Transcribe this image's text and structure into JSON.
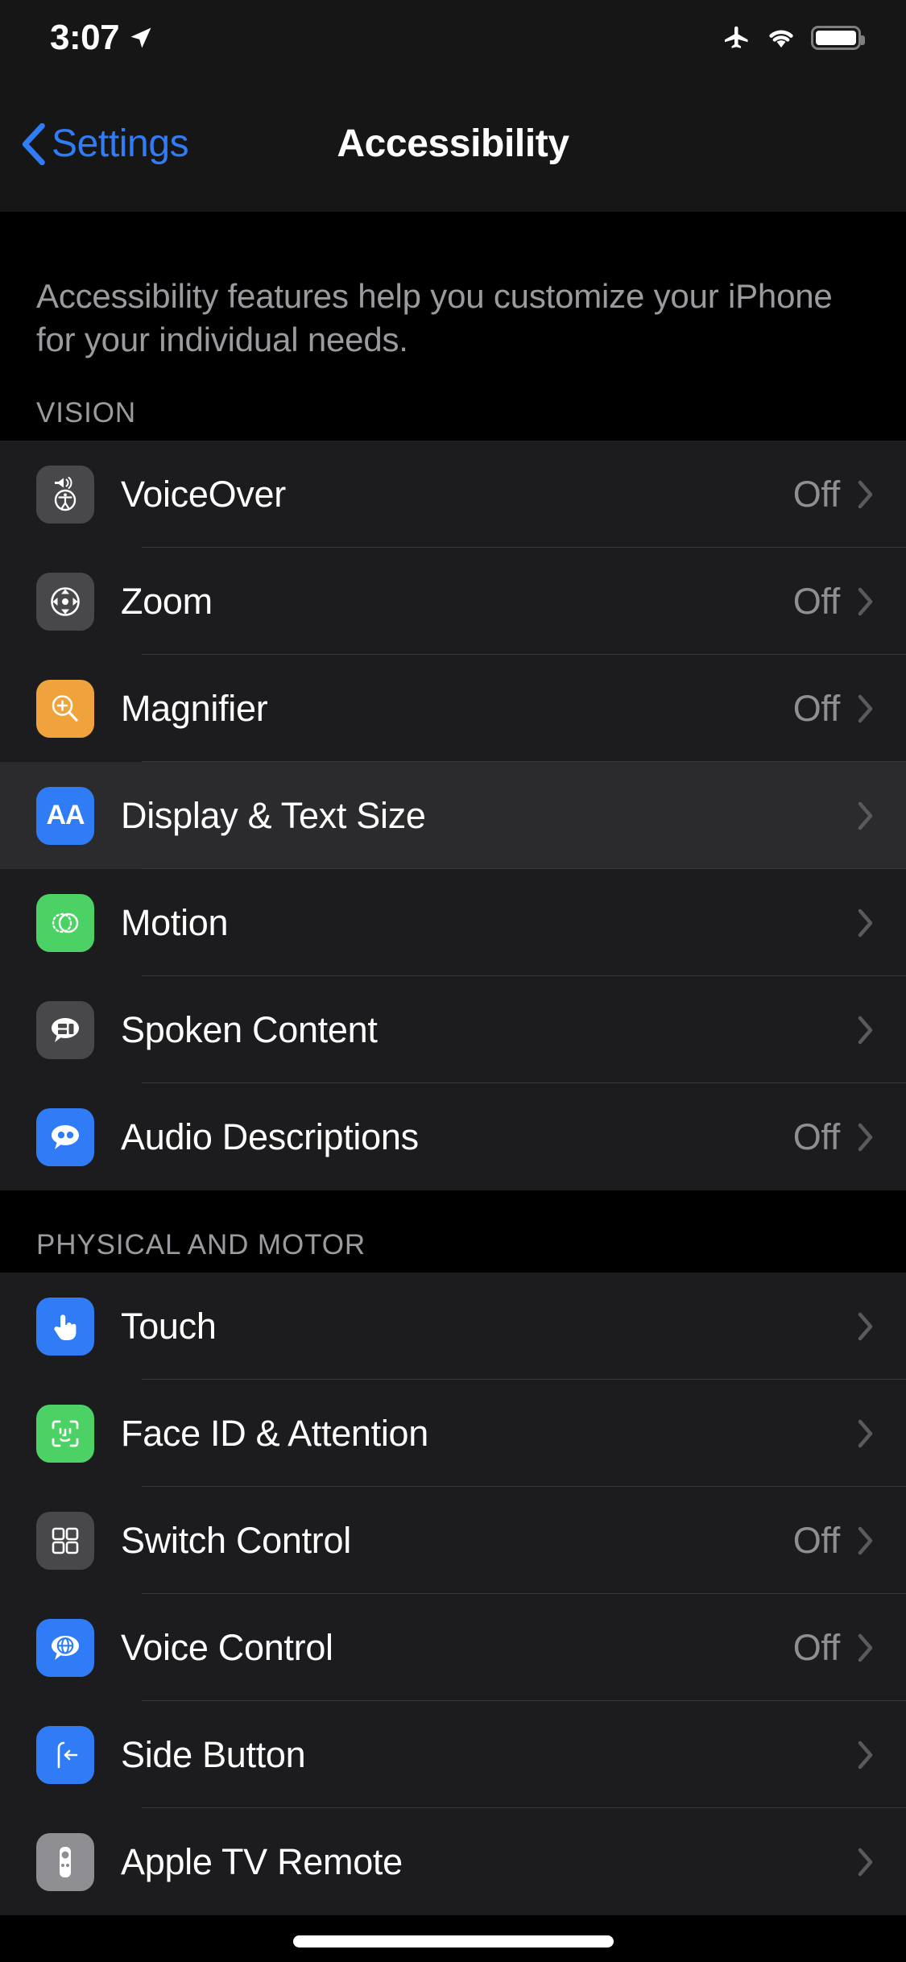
{
  "status_bar": {
    "time": "3:07",
    "icons": [
      "location-arrow-icon",
      "airplane-mode-icon",
      "wifi-icon",
      "battery-icon"
    ]
  },
  "nav": {
    "back_label": "Settings",
    "title": "Accessibility"
  },
  "blurb": "Accessibility features help you customize your iPhone for your individual needs.",
  "sections": [
    {
      "header": "VISION",
      "rows": [
        {
          "label": "VoiceOver",
          "value": "Off",
          "icon": "voiceover-icon",
          "icon_color": "#48484a"
        },
        {
          "label": "Zoom",
          "value": "Off",
          "icon": "zoom-icon",
          "icon_color": "#48484a"
        },
        {
          "label": "Magnifier",
          "value": "Off",
          "icon": "magnifier-icon",
          "icon_color": "#f0a33c"
        },
        {
          "label": "Display & Text Size",
          "value": "",
          "icon": "display-text-size-icon",
          "icon_color": "#2f7cf6",
          "highlighted": true
        },
        {
          "label": "Motion",
          "value": "",
          "icon": "motion-icon",
          "icon_color": "#4cd264"
        },
        {
          "label": "Spoken Content",
          "value": "",
          "icon": "spoken-content-icon",
          "icon_color": "#48484a"
        },
        {
          "label": "Audio Descriptions",
          "value": "Off",
          "icon": "audio-descriptions-icon",
          "icon_color": "#2f7cf6"
        }
      ]
    },
    {
      "header": "PHYSICAL AND MOTOR",
      "rows": [
        {
          "label": "Touch",
          "value": "",
          "icon": "touch-icon",
          "icon_color": "#2f7cf6"
        },
        {
          "label": "Face ID & Attention",
          "value": "",
          "icon": "face-id-icon",
          "icon_color": "#4cd264"
        },
        {
          "label": "Switch Control",
          "value": "Off",
          "icon": "switch-control-icon",
          "icon_color": "#48484a"
        },
        {
          "label": "Voice Control",
          "value": "Off",
          "icon": "voice-control-icon",
          "icon_color": "#2f7cf6"
        },
        {
          "label": "Side Button",
          "value": "",
          "icon": "side-button-icon",
          "icon_color": "#2f7cf6"
        },
        {
          "label": "Apple TV Remote",
          "value": "",
          "icon": "apple-tv-remote-icon",
          "icon_color": "#8e8e93"
        }
      ]
    }
  ],
  "display_text_size_icon_text": "AA",
  "colors": {
    "accent_blue": "#2f7cf6",
    "row_bg": "#1c1c1e",
    "row_highlight_bg": "#2b2b2d",
    "page_bg": "#000000",
    "secondary_text": "#8e8e93"
  }
}
